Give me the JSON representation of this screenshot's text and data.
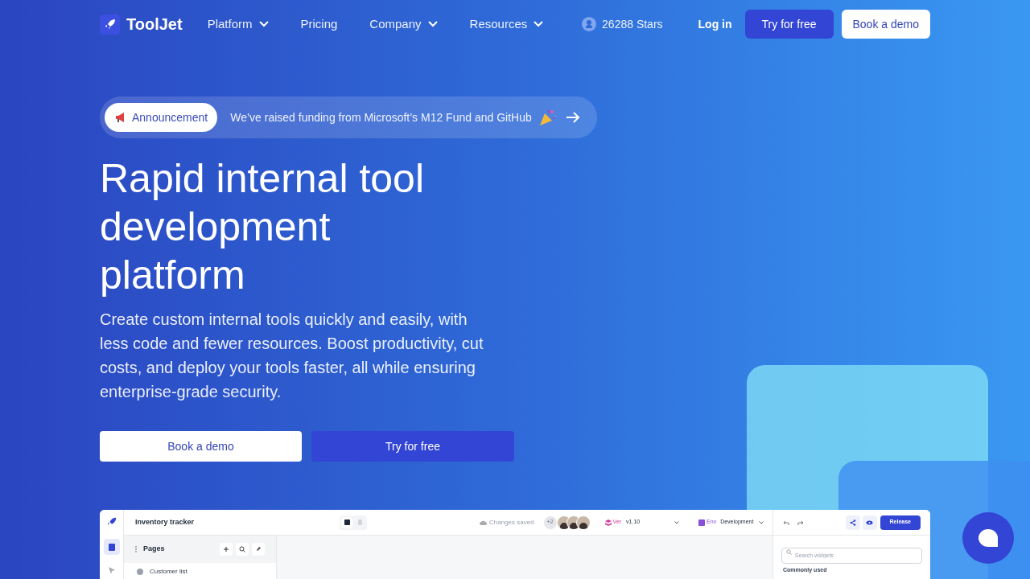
{
  "nav": {
    "logo": "ToolJet",
    "links": [
      {
        "label": "Platform",
        "dropdown": true
      },
      {
        "label": "Pricing",
        "dropdown": false
      },
      {
        "label": "Company",
        "dropdown": true
      },
      {
        "label": "Resources",
        "dropdown": true
      }
    ],
    "stars": "26288 Stars",
    "login": "Log in",
    "try_button": "Try for free",
    "demo_button": "Book a demo"
  },
  "announcement": {
    "badge": "Announcement",
    "text": "We’ve raised funding from Microsoft’s M12 Fund and GitHub"
  },
  "hero": {
    "title": "Rapid internal tool development platform",
    "subtitle": "Create custom internal tools quickly and easily, with less code and fewer resources. Boost productivity, cut costs, and deploy your tools faster, all while ensuring enterprise-grade security.",
    "demo_button": "Book a demo",
    "try_button": "Try for free"
  },
  "app_preview": {
    "app_name": "Inventory tracker",
    "devices": [
      {
        "selected": true
      },
      {
        "selected": false
      }
    ],
    "save_status": "Changes saved",
    "extra_users": "+2",
    "version_label": "Ver",
    "version": "v1.10",
    "env_label": "Env",
    "environment": "Development",
    "release_button": "Release",
    "pages_title": "Pages",
    "pages": [
      "Customer list"
    ],
    "search_placeholder": "Search widgets",
    "section_title": "Commonly used"
  }
}
